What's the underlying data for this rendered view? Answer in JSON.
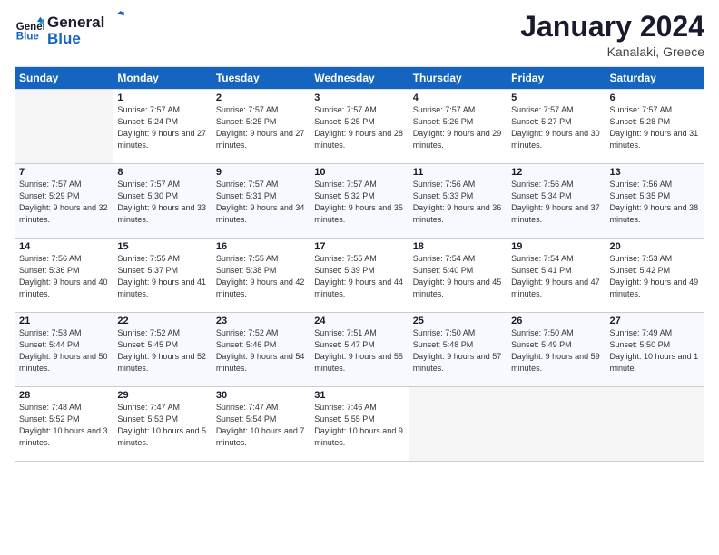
{
  "logo": {
    "line1": "General",
    "line2": "Blue"
  },
  "header": {
    "month": "January 2024",
    "location": "Kanalaki, Greece"
  },
  "weekdays": [
    "Sunday",
    "Monday",
    "Tuesday",
    "Wednesday",
    "Thursday",
    "Friday",
    "Saturday"
  ],
  "weeks": [
    [
      {
        "day": "",
        "sunrise": "",
        "sunset": "",
        "daylight": ""
      },
      {
        "day": "1",
        "sunrise": "Sunrise: 7:57 AM",
        "sunset": "Sunset: 5:24 PM",
        "daylight": "Daylight: 9 hours and 27 minutes."
      },
      {
        "day": "2",
        "sunrise": "Sunrise: 7:57 AM",
        "sunset": "Sunset: 5:25 PM",
        "daylight": "Daylight: 9 hours and 27 minutes."
      },
      {
        "day": "3",
        "sunrise": "Sunrise: 7:57 AM",
        "sunset": "Sunset: 5:25 PM",
        "daylight": "Daylight: 9 hours and 28 minutes."
      },
      {
        "day": "4",
        "sunrise": "Sunrise: 7:57 AM",
        "sunset": "Sunset: 5:26 PM",
        "daylight": "Daylight: 9 hours and 29 minutes."
      },
      {
        "day": "5",
        "sunrise": "Sunrise: 7:57 AM",
        "sunset": "Sunset: 5:27 PM",
        "daylight": "Daylight: 9 hours and 30 minutes."
      },
      {
        "day": "6",
        "sunrise": "Sunrise: 7:57 AM",
        "sunset": "Sunset: 5:28 PM",
        "daylight": "Daylight: 9 hours and 31 minutes."
      }
    ],
    [
      {
        "day": "7",
        "sunrise": "Sunrise: 7:57 AM",
        "sunset": "Sunset: 5:29 PM",
        "daylight": "Daylight: 9 hours and 32 minutes."
      },
      {
        "day": "8",
        "sunrise": "Sunrise: 7:57 AM",
        "sunset": "Sunset: 5:30 PM",
        "daylight": "Daylight: 9 hours and 33 minutes."
      },
      {
        "day": "9",
        "sunrise": "Sunrise: 7:57 AM",
        "sunset": "Sunset: 5:31 PM",
        "daylight": "Daylight: 9 hours and 34 minutes."
      },
      {
        "day": "10",
        "sunrise": "Sunrise: 7:57 AM",
        "sunset": "Sunset: 5:32 PM",
        "daylight": "Daylight: 9 hours and 35 minutes."
      },
      {
        "day": "11",
        "sunrise": "Sunrise: 7:56 AM",
        "sunset": "Sunset: 5:33 PM",
        "daylight": "Daylight: 9 hours and 36 minutes."
      },
      {
        "day": "12",
        "sunrise": "Sunrise: 7:56 AM",
        "sunset": "Sunset: 5:34 PM",
        "daylight": "Daylight: 9 hours and 37 minutes."
      },
      {
        "day": "13",
        "sunrise": "Sunrise: 7:56 AM",
        "sunset": "Sunset: 5:35 PM",
        "daylight": "Daylight: 9 hours and 38 minutes."
      }
    ],
    [
      {
        "day": "14",
        "sunrise": "Sunrise: 7:56 AM",
        "sunset": "Sunset: 5:36 PM",
        "daylight": "Daylight: 9 hours and 40 minutes."
      },
      {
        "day": "15",
        "sunrise": "Sunrise: 7:55 AM",
        "sunset": "Sunset: 5:37 PM",
        "daylight": "Daylight: 9 hours and 41 minutes."
      },
      {
        "day": "16",
        "sunrise": "Sunrise: 7:55 AM",
        "sunset": "Sunset: 5:38 PM",
        "daylight": "Daylight: 9 hours and 42 minutes."
      },
      {
        "day": "17",
        "sunrise": "Sunrise: 7:55 AM",
        "sunset": "Sunset: 5:39 PM",
        "daylight": "Daylight: 9 hours and 44 minutes."
      },
      {
        "day": "18",
        "sunrise": "Sunrise: 7:54 AM",
        "sunset": "Sunset: 5:40 PM",
        "daylight": "Daylight: 9 hours and 45 minutes."
      },
      {
        "day": "19",
        "sunrise": "Sunrise: 7:54 AM",
        "sunset": "Sunset: 5:41 PM",
        "daylight": "Daylight: 9 hours and 47 minutes."
      },
      {
        "day": "20",
        "sunrise": "Sunrise: 7:53 AM",
        "sunset": "Sunset: 5:42 PM",
        "daylight": "Daylight: 9 hours and 49 minutes."
      }
    ],
    [
      {
        "day": "21",
        "sunrise": "Sunrise: 7:53 AM",
        "sunset": "Sunset: 5:44 PM",
        "daylight": "Daylight: 9 hours and 50 minutes."
      },
      {
        "day": "22",
        "sunrise": "Sunrise: 7:52 AM",
        "sunset": "Sunset: 5:45 PM",
        "daylight": "Daylight: 9 hours and 52 minutes."
      },
      {
        "day": "23",
        "sunrise": "Sunrise: 7:52 AM",
        "sunset": "Sunset: 5:46 PM",
        "daylight": "Daylight: 9 hours and 54 minutes."
      },
      {
        "day": "24",
        "sunrise": "Sunrise: 7:51 AM",
        "sunset": "Sunset: 5:47 PM",
        "daylight": "Daylight: 9 hours and 55 minutes."
      },
      {
        "day": "25",
        "sunrise": "Sunrise: 7:50 AM",
        "sunset": "Sunset: 5:48 PM",
        "daylight": "Daylight: 9 hours and 57 minutes."
      },
      {
        "day": "26",
        "sunrise": "Sunrise: 7:50 AM",
        "sunset": "Sunset: 5:49 PM",
        "daylight": "Daylight: 9 hours and 59 minutes."
      },
      {
        "day": "27",
        "sunrise": "Sunrise: 7:49 AM",
        "sunset": "Sunset: 5:50 PM",
        "daylight": "Daylight: 10 hours and 1 minute."
      }
    ],
    [
      {
        "day": "28",
        "sunrise": "Sunrise: 7:48 AM",
        "sunset": "Sunset: 5:52 PM",
        "daylight": "Daylight: 10 hours and 3 minutes."
      },
      {
        "day": "29",
        "sunrise": "Sunrise: 7:47 AM",
        "sunset": "Sunset: 5:53 PM",
        "daylight": "Daylight: 10 hours and 5 minutes."
      },
      {
        "day": "30",
        "sunrise": "Sunrise: 7:47 AM",
        "sunset": "Sunset: 5:54 PM",
        "daylight": "Daylight: 10 hours and 7 minutes."
      },
      {
        "day": "31",
        "sunrise": "Sunrise: 7:46 AM",
        "sunset": "Sunset: 5:55 PM",
        "daylight": "Daylight: 10 hours and 9 minutes."
      },
      {
        "day": "",
        "sunrise": "",
        "sunset": "",
        "daylight": ""
      },
      {
        "day": "",
        "sunrise": "",
        "sunset": "",
        "daylight": ""
      },
      {
        "day": "",
        "sunrise": "",
        "sunset": "",
        "daylight": ""
      }
    ]
  ]
}
